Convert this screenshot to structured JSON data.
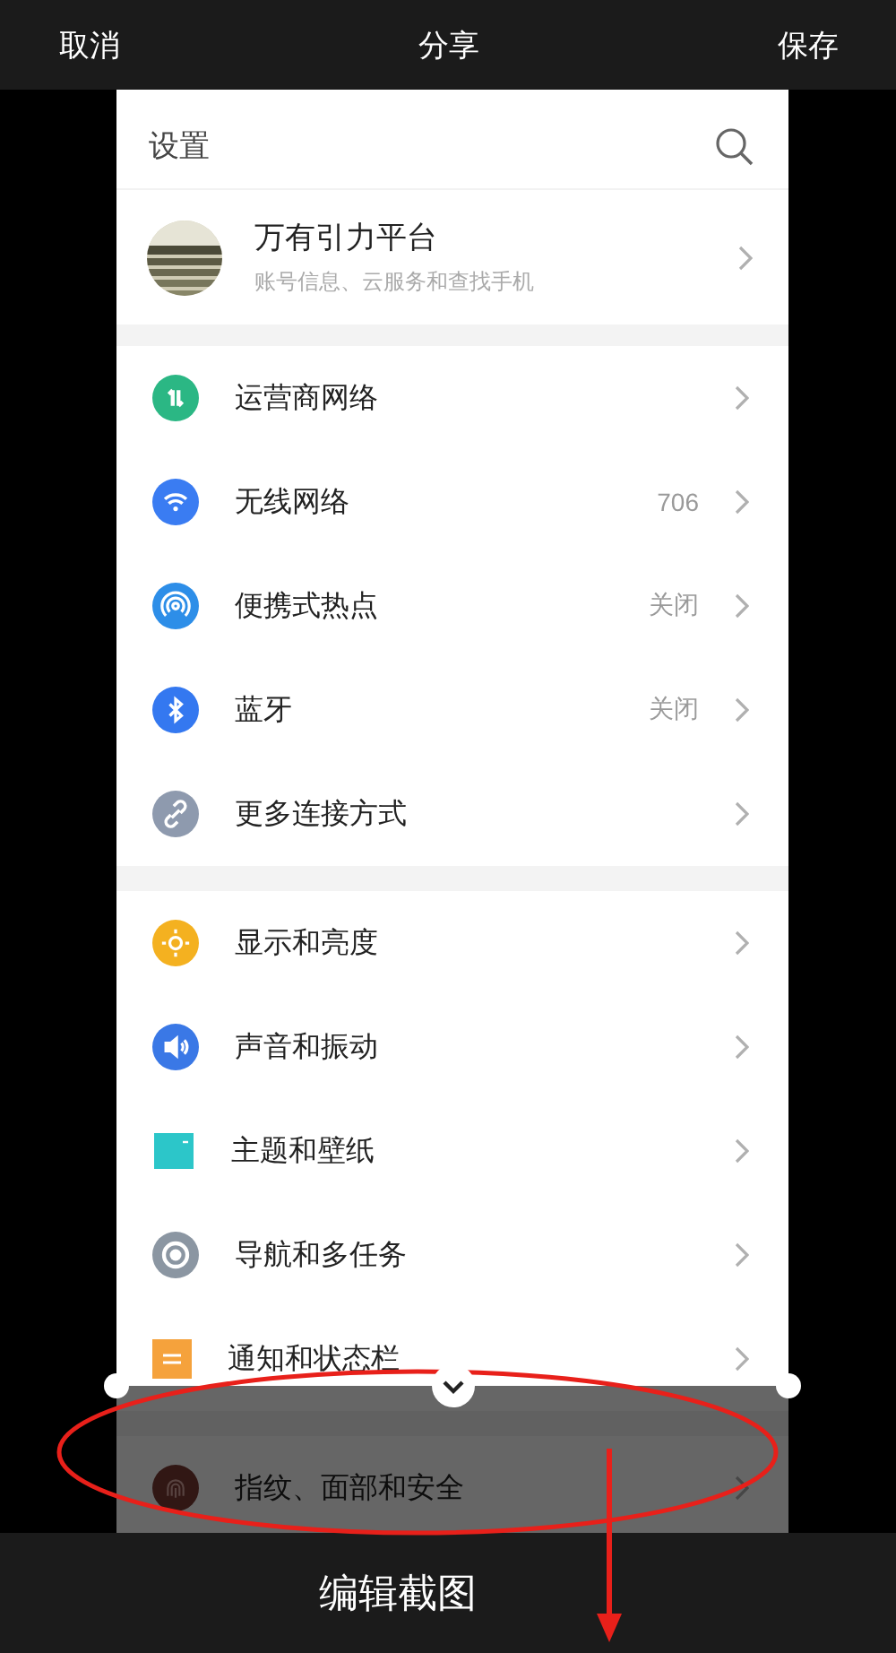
{
  "top_bar": {
    "cancel": "取消",
    "title": "分享",
    "save": "保存"
  },
  "settings": {
    "title": "设置",
    "account": {
      "name": "万有引力平台",
      "subtitle": "账号信息、云服务和查找手机"
    },
    "groups": [
      [
        {
          "kind": "carrier",
          "label": "运营商网络"
        },
        {
          "kind": "wifi",
          "label": "无线网络",
          "value": "706"
        },
        {
          "kind": "hotspot",
          "label": "便携式热点",
          "value": "关闭"
        },
        {
          "kind": "bluetooth",
          "label": "蓝牙",
          "value": "关闭"
        },
        {
          "kind": "link",
          "label": "更多连接方式"
        }
      ],
      [
        {
          "kind": "display",
          "label": "显示和亮度"
        },
        {
          "kind": "sound",
          "label": "声音和振动"
        },
        {
          "kind": "theme",
          "label": "主题和壁纸"
        },
        {
          "kind": "navigation",
          "label": "导航和多任务"
        },
        {
          "kind": "notification",
          "label": "通知和状态栏"
        }
      ],
      [
        {
          "kind": "fingerprint",
          "label": "指纹、面部和安全"
        }
      ]
    ]
  },
  "crop": {
    "overlay": true
  },
  "bottom_bar": {
    "title": "编辑截图"
  },
  "annotation": {
    "ellipse": true,
    "arrow": true
  }
}
